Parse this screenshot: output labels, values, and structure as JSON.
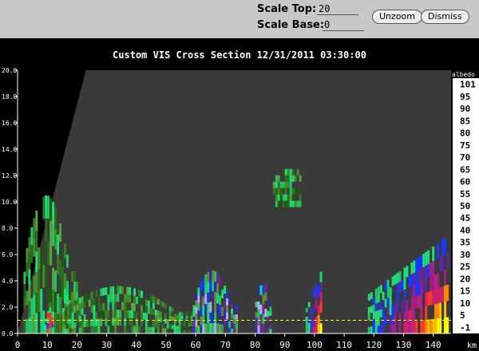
{
  "toolbar": {
    "scale_top_label": "Scale Top:",
    "scale_top_value": "20",
    "scale_base_label": "Scale Base:",
    "scale_base_value": "0",
    "unzoom_label": "Unzoom",
    "dismiss_label": "Dismiss"
  },
  "title": "Custom   VIS Cross Section 12/31/2011 03:30:00",
  "colors": {
    "background": "#000000",
    "plot_fill": "#3a3a3a",
    "toolbar": "#c8c8c8",
    "reference_line": "#ffff00",
    "axis_text": "#ffffff"
  },
  "chart_data": {
    "type": "heatmap",
    "x_axis": {
      "unit_label": "km",
      "range": [
        0,
        146
      ],
      "ticks": [
        "0",
        "10",
        "20",
        "30",
        "40",
        "50",
        "60",
        "70",
        "80",
        "90",
        "100",
        "110",
        "120",
        "130",
        "140"
      ]
    },
    "y_axis": {
      "range": [
        0,
        20
      ],
      "ticks": [
        "0.0",
        "2.0",
        "4.0",
        "6.0",
        "8.0",
        "10.0",
        "12.0",
        "14.0",
        "16.0",
        "18.0",
        "20.0"
      ]
    },
    "reference_line_height": 1.0,
    "colorbar": {
      "title": "albedo",
      "labels": [
        "101",
        "95",
        "90",
        "85",
        "80",
        "75",
        "70",
        "65",
        "60",
        "55",
        "50",
        "45",
        "40",
        "35",
        "30",
        "25",
        "20",
        "15",
        "10",
        "5",
        "-1"
      ]
    },
    "features": [
      {
        "x_range": [
          2,
          20
        ],
        "top": 10.5,
        "palette": "green"
      },
      {
        "x_range": [
          9,
          12
        ],
        "top": 2.5,
        "palette": "red"
      },
      {
        "x_range": [
          15,
          60
        ],
        "top": 3.6,
        "palette": "green"
      },
      {
        "x_range": [
          59,
          74
        ],
        "top": 4.8,
        "palette": "blue"
      },
      {
        "x_range": [
          80,
          85
        ],
        "top": 4.5,
        "palette": "blue"
      },
      {
        "x_range": [
          86,
          95
        ],
        "top": 12.5,
        "palette": "green"
      },
      {
        "x_range": [
          97,
          102
        ],
        "top": 4.8,
        "palette": "yellow"
      },
      {
        "x_range": [
          118,
          145
        ],
        "top": 7.5,
        "palette": "yellow"
      }
    ]
  }
}
